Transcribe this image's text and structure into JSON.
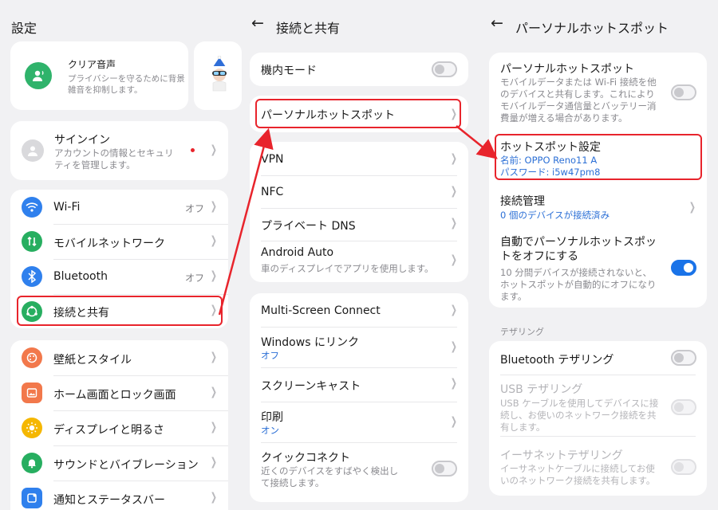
{
  "panel1": {
    "title": "設定",
    "banner": {
      "title": "クリア音声",
      "desc": "プライバシーを守るために背景雑音を抑制します。"
    },
    "signin": {
      "title": "サインイン",
      "desc": "アカウントの情報とセキュリティを管理します。"
    },
    "network": [
      {
        "label": "Wi-Fi",
        "status": "オフ",
        "color": "#2f80ed"
      },
      {
        "label": "モバイルネットワーク",
        "status": "",
        "color": "#27ae60"
      },
      {
        "label": "Bluetooth",
        "status": "オフ",
        "color": "#2f80ed"
      },
      {
        "label": "接続と共有",
        "status": "",
        "color": "#27ae60"
      }
    ],
    "display": [
      {
        "label": "壁紙とスタイル",
        "color": "#f2784b"
      },
      {
        "label": "ホーム画面とロック画面",
        "color": "#f2784b"
      },
      {
        "label": "ディスプレイと明るさ",
        "color": "#f5b700"
      },
      {
        "label": "サウンドとバイブレーション",
        "color": "#27ae60"
      },
      {
        "label": "通知とステータスバー",
        "color": "#2f80ed"
      }
    ]
  },
  "panel2": {
    "title": "接続と共有",
    "airplane": "機内モード",
    "hotspot": "パーソナルホットスポット",
    "group2": [
      "VPN",
      "NFC",
      "プライベート DNS"
    ],
    "android_auto": {
      "title": "Android Auto",
      "desc": "車のディスプレイでアプリを使用します。"
    },
    "multiscreen": "Multi-Screen Connect",
    "windows_link": {
      "title": "Windows にリンク",
      "status": "オフ"
    },
    "screencast": "スクリーンキャスト",
    "print": {
      "title": "印刷",
      "status": "オン"
    },
    "quick_connect": {
      "title": "クイックコネクト",
      "desc": "近くのデバイスをすばやく検出して接続します。"
    }
  },
  "panel3": {
    "title": "パーソナルホットスポット",
    "hotspot": {
      "title": "パーソナルホットスポット",
      "desc": "モバイルデータまたは Wi-Fi 接続を他のデバイスと共有します。これによりモバイルデータ通信量とバッテリー消費量が増える場合があります。"
    },
    "settings": {
      "title": "ホットスポット設定",
      "name": "名前: OPPO Reno11 A",
      "password": "パスワード: i5w47pm8"
    },
    "manage": {
      "title": "接続管理",
      "status": "0 個のデバイスが接続済み"
    },
    "auto_off": {
      "title": "自動でパーソナルホットスポットをオフにする",
      "desc": "10 分間デバイスが接続されないと、ホットスポットが自動的にオフになります。"
    },
    "tethering_label": "テザリング",
    "bt_tether": "Bluetooth テザリング",
    "usb_tether": {
      "title": "USB テザリング",
      "desc": "USB ケーブルを使用してデバイスに接続し、お使いのネットワーク接続を共有します。"
    },
    "eth_tether": {
      "title": "イーサネットテザリング",
      "desc": "イーサネットケーブルに接続してお使いのネットワーク接続を共有します。"
    }
  },
  "colors": {
    "accent": "#1a73e8",
    "highlight": "#e8242c"
  }
}
